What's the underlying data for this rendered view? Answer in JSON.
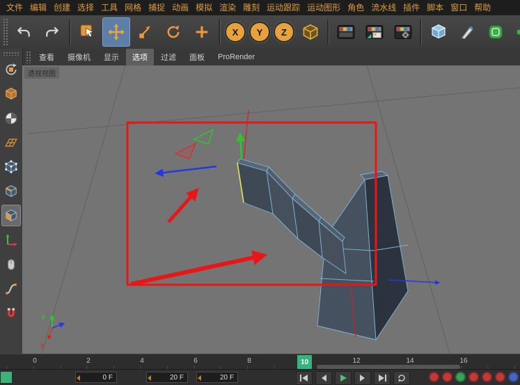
{
  "menubar": {
    "items": [
      "文件",
      "编辑",
      "创建",
      "选择",
      "工具",
      "网格",
      "捕捉",
      "动画",
      "模拟",
      "渲染",
      "雕刻",
      "运动跟踪",
      "运动图形",
      "角色",
      "流水线",
      "插件",
      "脚本",
      "窗口",
      "帮助"
    ]
  },
  "toolbar": {
    "axis_locks": [
      "X",
      "Y",
      "Z"
    ],
    "icons": [
      "undo",
      "redo",
      "live-selection",
      "move",
      "scale",
      "rotate",
      "add",
      "x-axis-lock",
      "y-axis-lock",
      "z-axis-lock",
      "coordinate-system",
      "render-view",
      "render-picture-viewer",
      "render-settings",
      "primitive-cube",
      "spline-pen",
      "subdivision-surface",
      "array-generator",
      "bend-deformer"
    ],
    "selected_tool": "move"
  },
  "viewport_menu": {
    "items": [
      "查看",
      "摄像机",
      "显示",
      "选项",
      "过滤",
      "面板",
      "ProRender"
    ],
    "active": "选项"
  },
  "side_toolbar": {
    "icons": [
      "convert-to-editable",
      "model-mode",
      "texture-mode",
      "workplane-mode",
      "points-mode",
      "edges-mode",
      "polygons-mode",
      "enable-axis",
      "viewport-solo",
      "spline-tool",
      "snapping"
    ],
    "selected": "polygons-mode"
  },
  "viewport": {
    "view_label": "透视视图",
    "axis_labels": {
      "x": "X",
      "y": "Y"
    }
  },
  "timeline": {
    "ticks": [
      "0",
      "2",
      "4",
      "6",
      "8",
      "12",
      "14",
      "16"
    ],
    "current_frame": "10"
  },
  "playback": {
    "start_frame": "0 F",
    "end_frame": "20 F",
    "max_frame": "20 F"
  },
  "colors": {
    "accent_orange": "#e8a23c",
    "menu_text": "#dd9c3e",
    "annotation_red": "#e81717",
    "marker_green": "#35b57c",
    "viewport_gray": "#747474",
    "mesh_face": "#46515f",
    "mesh_edge_blue": "#7db6da"
  }
}
